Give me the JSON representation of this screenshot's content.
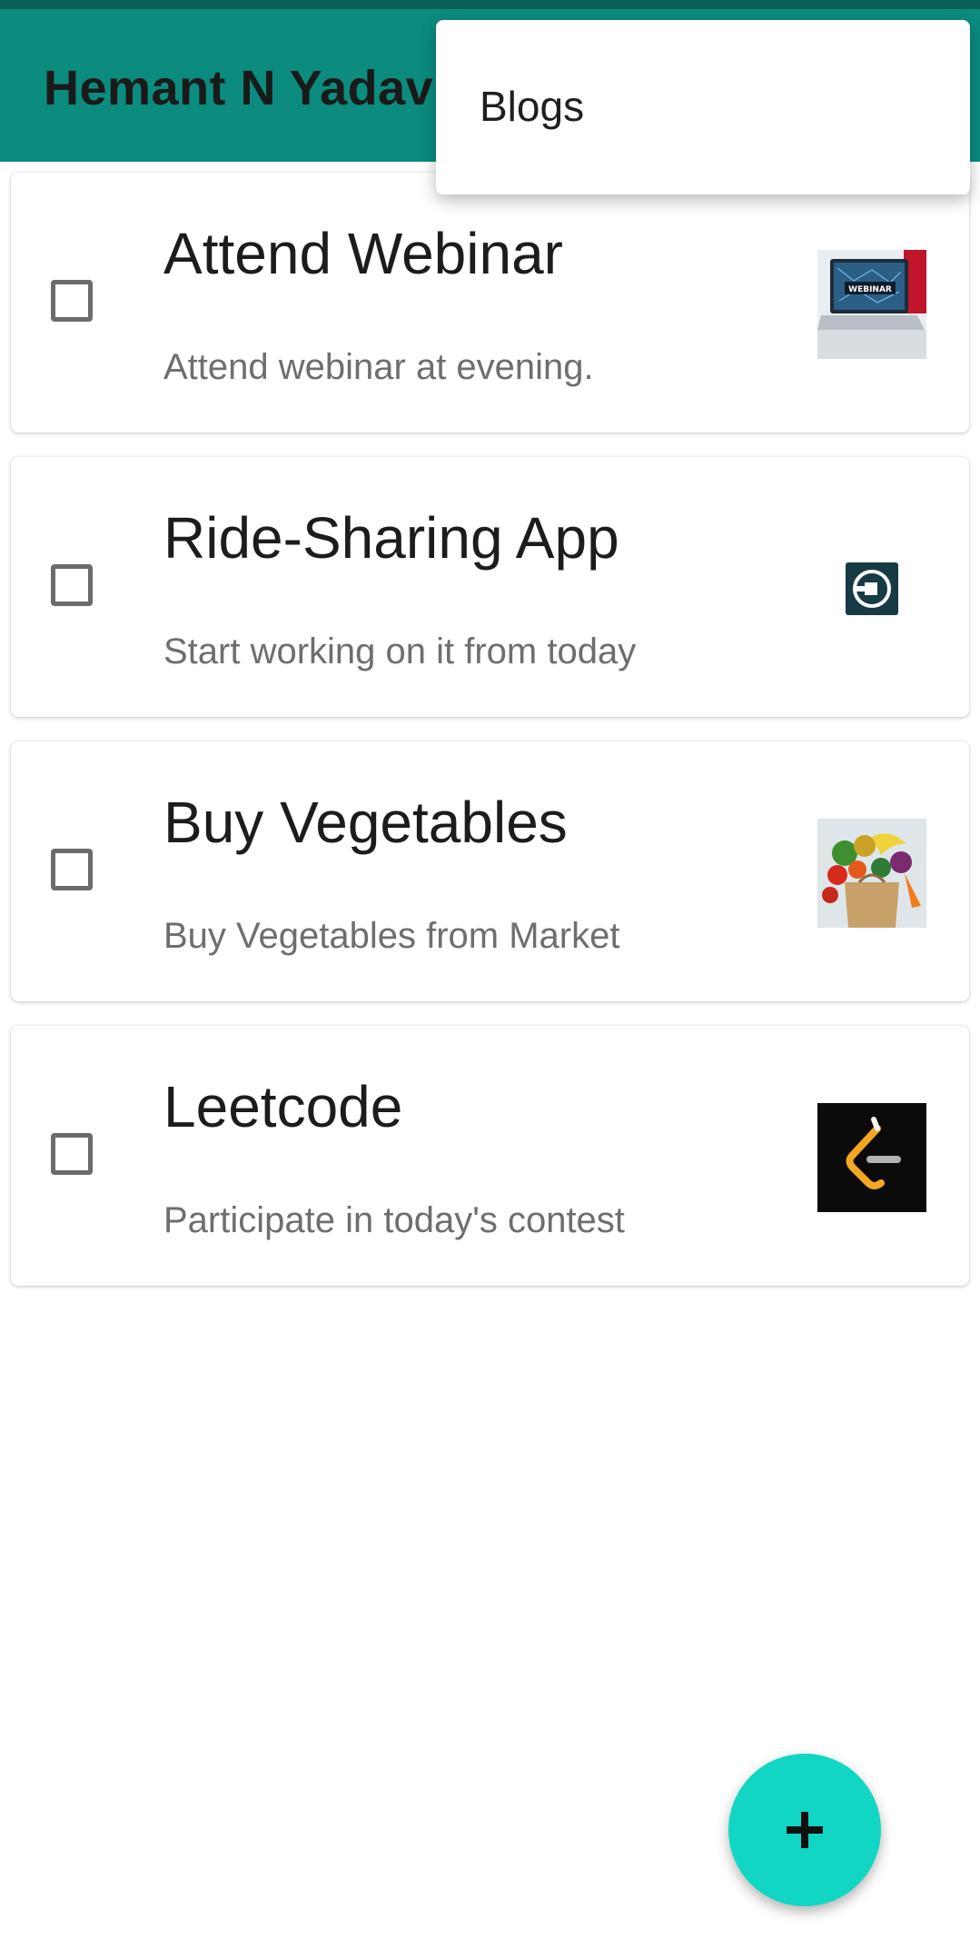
{
  "app_bar": {
    "title": "Hemant N Yadav"
  },
  "overflow_menu": {
    "items": [
      {
        "label": "Blogs"
      }
    ]
  },
  "tasks": [
    {
      "title": "Attend Webinar",
      "description": "Attend webinar at evening.",
      "checked": false,
      "image": "webinar-laptop-image"
    },
    {
      "title": "Ride-Sharing App",
      "description": "Start working on it from today",
      "checked": false,
      "image": "uber-logo"
    },
    {
      "title": "Buy Vegetables",
      "description": "Buy Vegetables from Market",
      "checked": false,
      "image": "vegetables-bag-image"
    },
    {
      "title": "Leetcode",
      "description": "Participate in today's contest",
      "checked": false,
      "image": "leetcode-logo"
    }
  ],
  "fab": {
    "icon": "plus-icon"
  },
  "colors": {
    "app_bar": "#0b8c7f",
    "fab": "#12d6c4",
    "status_strip": "#0a5e58"
  }
}
